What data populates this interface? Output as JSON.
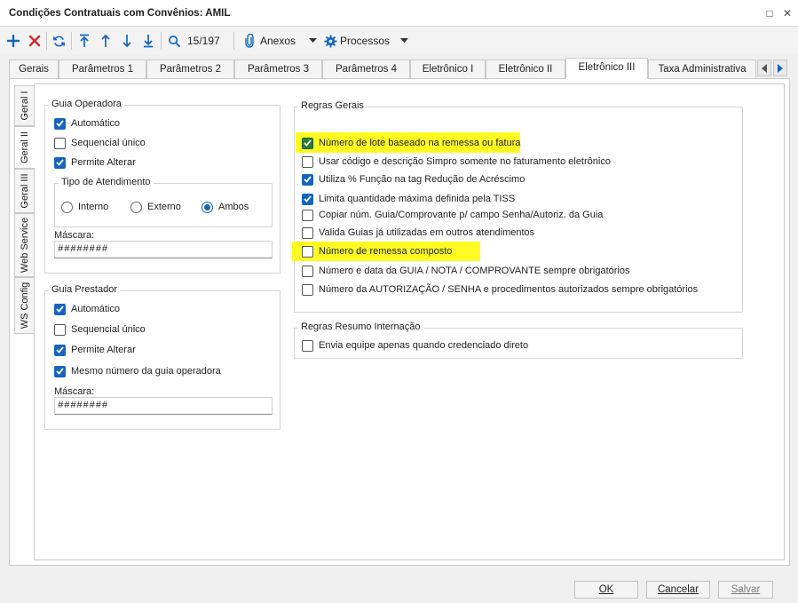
{
  "window": {
    "title": "Condições Contratuais com Convênios: AMIL",
    "maximize_glyph": "□",
    "close_glyph": "✕"
  },
  "toolbar": {
    "record_counter": "15/197",
    "attachments_label": "Anexos",
    "processes_label": "Processos",
    "icons": [
      "add-icon",
      "delete-icon",
      "refresh-icon",
      "first-record-icon",
      "previous-record-icon",
      "next-record-icon",
      "last-record-icon",
      "search-icon",
      "paperclip-icon",
      "gear-icon"
    ]
  },
  "tabs": [
    "Gerais",
    "Parâmetros 1",
    "Parâmetros 2",
    "Parâmetros 3",
    "Parâmetros 4",
    "Eletrônico I",
    "Eletrônico II",
    "Eletrônico III",
    "Taxa Administrativa"
  ],
  "active_tab": "Eletrônico III",
  "side_tabs": [
    "Geral I",
    "Geral II",
    "Geral III",
    "Web Service",
    "WS Config"
  ],
  "active_side_tab": "Geral II",
  "guia_operadora": {
    "title": "Guia Operadora",
    "automatico": {
      "label": "Automático",
      "checked": true
    },
    "sequencial": {
      "label": "Sequencial único",
      "checked": false
    },
    "permite_alterar": {
      "label": "Permite Alterar",
      "checked": true
    },
    "tipo_atendimento": {
      "title": "Tipo de Atendimento",
      "options": [
        "Interno",
        "Externo",
        "Ambos"
      ],
      "selected": "Ambos"
    },
    "mascara_label": "Máscara:",
    "mascara_value": "########"
  },
  "guia_prestador": {
    "title": "Guia Prestador",
    "automatico": {
      "label": "Automático",
      "checked": true
    },
    "sequencial": {
      "label": "Sequencial único",
      "checked": false
    },
    "permite_alterar": {
      "label": "Permite Alterar",
      "checked": true
    },
    "mesmo_numero": {
      "label": "Mesmo número da guia operadora",
      "checked": true
    },
    "mascara_label": "Máscara:",
    "mascara_value": "########"
  },
  "regras_gerais": {
    "title": "Regras Gerais",
    "items": [
      {
        "label": "Número de lote baseado na remessa ou fatura",
        "checked": true,
        "highlighted": true
      },
      {
        "label": "Usar código e descrição Simpro somente no faturamento eletrônico",
        "checked": false
      },
      {
        "label": "Utiliza % Função na tag Redução de Acréscimo",
        "checked": true
      },
      {
        "label": "Limita quantidade máxima definida pela TISS",
        "checked": true
      },
      {
        "label": "Copiar núm. Guia/Comprovante p/ campo Senha/Autoriz. da Guia",
        "checked": false
      },
      {
        "label": "Valida Guias já utilizadas em outros atendimentos",
        "checked": false
      },
      {
        "label": "Número de remessa composto",
        "checked": false,
        "highlighted": true
      },
      {
        "label": "Número e data da GUIA / NOTA / COMPROVANTE sempre obrigatórios",
        "checked": false
      },
      {
        "label": "Número da AUTORIZAÇÃO / SENHA e procedimentos autorizados sempre obrigatórios",
        "checked": false
      }
    ]
  },
  "regras_internacao": {
    "title": "Regras Resumo Internação",
    "items": [
      {
        "label": "Envia equipe apenas quando credenciado direto",
        "checked": false
      }
    ]
  },
  "buttons": {
    "ok": "OK",
    "cancel": "Cancelar",
    "save": "Salvar"
  },
  "colors": {
    "accent": "#1565c0",
    "highlight": "#fffb22",
    "highlight_check": "#2e7d32",
    "delete": "#d32f2f"
  }
}
